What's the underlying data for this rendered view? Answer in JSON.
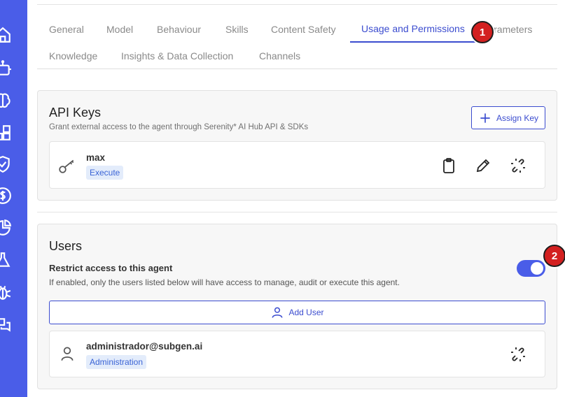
{
  "sidebar": {
    "items": [
      {
        "name": "home-icon"
      },
      {
        "name": "robot-icon"
      },
      {
        "name": "brain-icon"
      },
      {
        "name": "blocks-icon"
      },
      {
        "name": "shield-icon"
      },
      {
        "name": "dollar-icon"
      },
      {
        "name": "pie-chart-icon"
      },
      {
        "name": "flask-icon"
      },
      {
        "name": "bug-icon"
      },
      {
        "name": "chat-icon"
      }
    ]
  },
  "tabs": {
    "general": "General",
    "model": "Model",
    "behaviour": "Behaviour",
    "skills": "Skills",
    "content_safety": "Content Safety",
    "usage": "Usage and Permissions",
    "parameters": "Parameters",
    "knowledge": "Knowledge",
    "insights": "Insights & Data Collection",
    "channels": "Channels"
  },
  "badges": [
    "1",
    "2"
  ],
  "api_keys": {
    "title": "API Keys",
    "subtitle": "Grant external access to the agent through Serenity* AI Hub API & SDKs",
    "assign_label": "Assign Key",
    "key_name": "max",
    "key_tag": "Execute"
  },
  "users": {
    "title": "Users",
    "restrict_label": "Restrict access to this agent",
    "restrict_desc": "If enabled, only the users listed below will have access to manage, audit or execute this agent.",
    "restrict_enabled": true,
    "add_user_label": "Add User",
    "user_email": "administrador@subgen.ai",
    "user_tag": "Administration"
  },
  "colors": {
    "sidebar": "#4a5de8",
    "accent": "#3b4ccf",
    "badge": "#d32020"
  }
}
